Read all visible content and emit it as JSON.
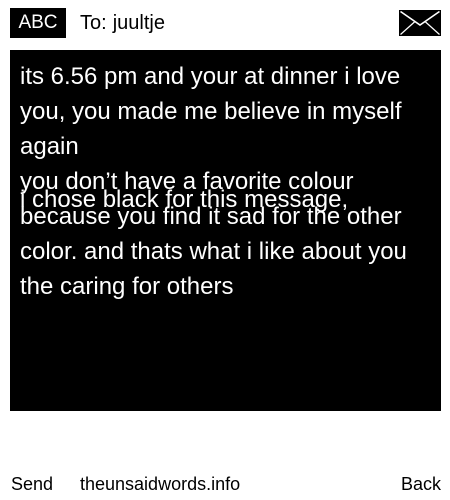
{
  "header": {
    "badge_label": "ABC",
    "to_prefix": "To:",
    "recipient": "juultje",
    "icon": "envelope-icon"
  },
  "message": {
    "body": "its 6.56 pm and your at dinner i love you, you made me believe in myself again\nyou don’t have a favorite colour because you find it sad for the other color. and thats what i like about you the caring for others",
    "overlap_note": "i chose black for this message,"
  },
  "footer": {
    "send_label": "Send",
    "site_label": "theunsaidwords.info",
    "back_label": "Back"
  },
  "colors": {
    "background": "#ffffff",
    "panel": "#000000",
    "panel_text": "#ffffff",
    "text": "#000000"
  }
}
